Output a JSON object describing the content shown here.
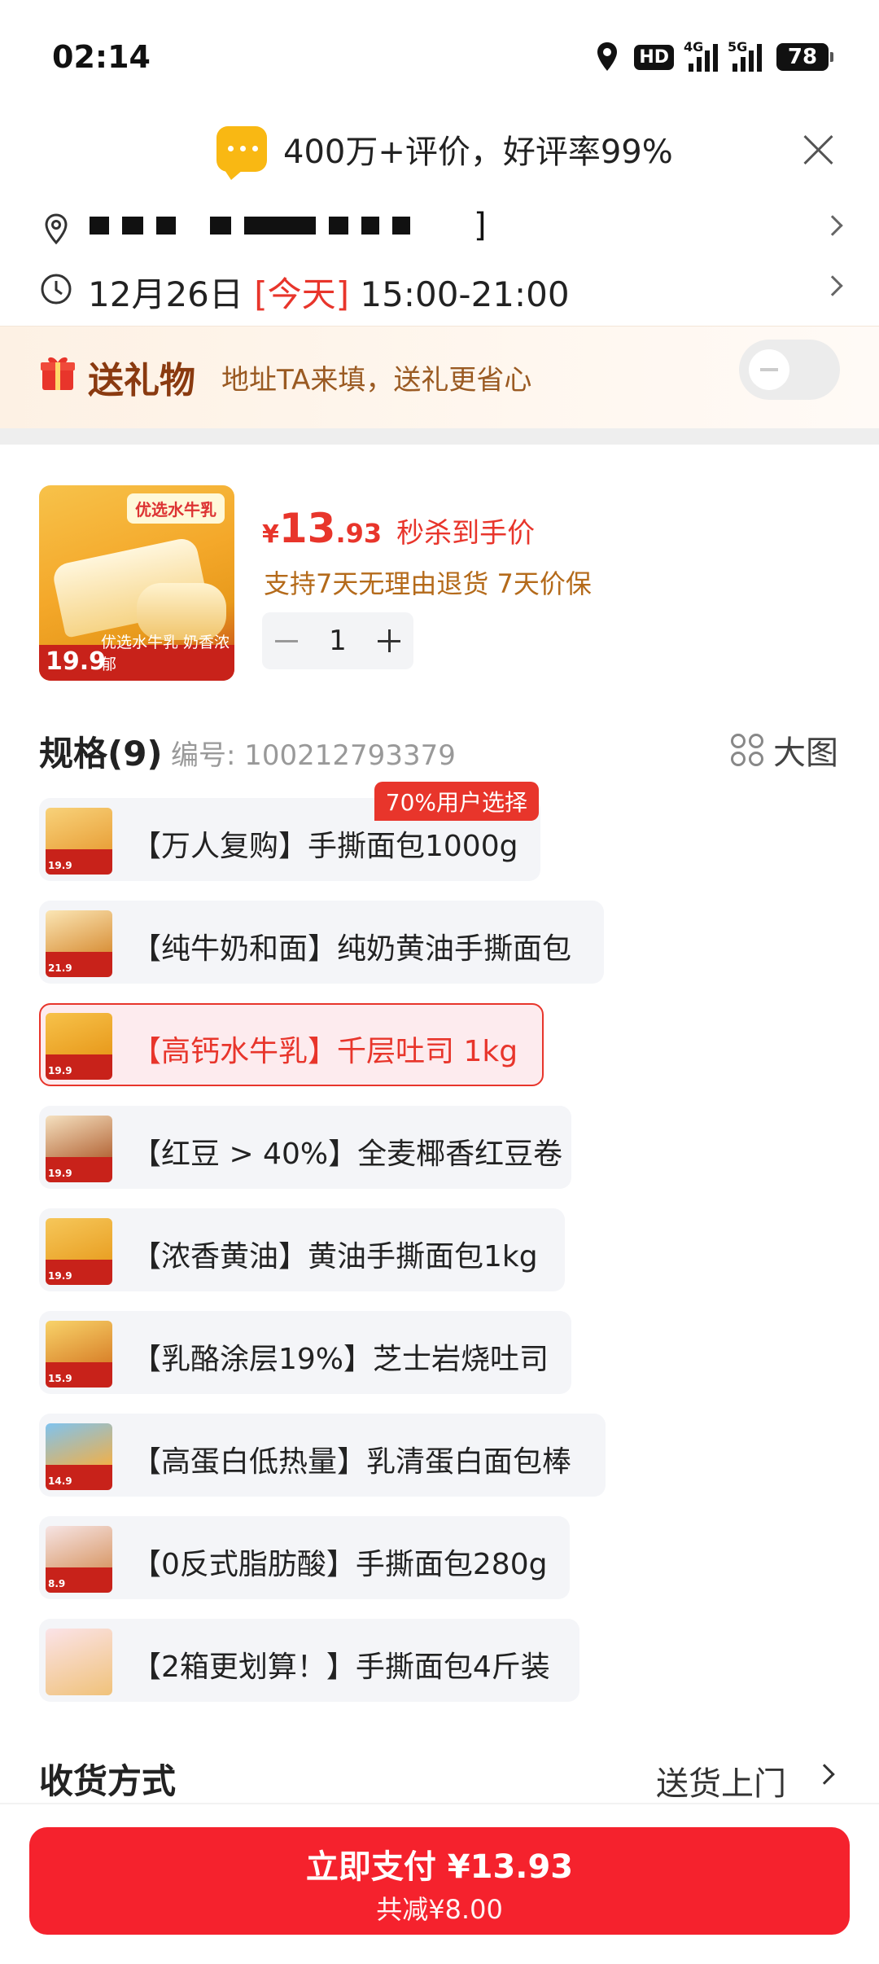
{
  "status_bar": {
    "time": "02:14",
    "hd": "HD",
    "network1": "4G",
    "network2": "5G",
    "battery": "78"
  },
  "review_banner": {
    "text": "400万+评价，好评率99%"
  },
  "address": {
    "masked_end": "]"
  },
  "delivery_time": {
    "date": "12月26日",
    "today": "[今天]",
    "window": "15:00-21:00"
  },
  "gift": {
    "title": "送礼物",
    "desc": "地址TA来填，送礼更省心",
    "enabled": false
  },
  "product": {
    "thumb_tag": "优选水牛乳",
    "thumb_price": "19.9",
    "thumb_strip": "优选水牛乳 奶香浓郁",
    "currency": "¥",
    "price_int": "13",
    "price_dec": ".93",
    "price_tag": "秒杀到手价",
    "guarantee": "支持7天无理由退货  7天价保",
    "quantity": "1"
  },
  "spec": {
    "title": "规格(9)",
    "code": "编号: 100212793379",
    "bigpic_label": "大图",
    "options": [
      {
        "label": "【万人复购】手撕面包1000g",
        "badge": "70%用户选择",
        "price": "19.9"
      },
      {
        "label": "【纯牛奶和面】纯奶黄油手撕面包",
        "price": "21.9"
      },
      {
        "label": "【高钙水牛乳】千层吐司 1kg",
        "price": "19.9"
      },
      {
        "label": "【红豆 > 40%】全麦椰香红豆卷",
        "price": "19.9"
      },
      {
        "label": "【浓香黄油】黄油手撕面包1kg",
        "price": "19.9"
      },
      {
        "label": "【乳酪涂层19%】芝士岩烧吐司",
        "price": "15.9"
      },
      {
        "label": "【高蛋白低热量】乳清蛋白面包棒",
        "price": "14.9"
      },
      {
        "label": "【0反式脂肪酸】手撕面包280g",
        "price": "8.9"
      },
      {
        "label": "【2箱更划算！】手撕面包4斤装",
        "price": ""
      }
    ],
    "selected_index": 2
  },
  "delivery": {
    "title": "收货方式",
    "value": "送货上门"
  },
  "pay": {
    "main": "立即支付 ¥13.93",
    "sub": "共减¥8.00"
  },
  "colors": {
    "accent": "#e8352b",
    "pay": "#f5222d",
    "gift_text": "#8a3a10"
  }
}
